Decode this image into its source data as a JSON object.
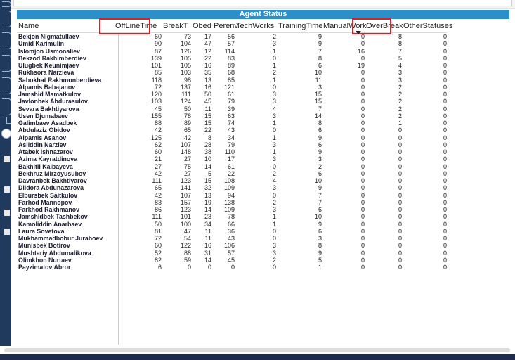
{
  "title": "Agent Status",
  "columns": [
    "Name",
    "OffLineTime",
    "BreakT",
    "Obed",
    "Pereriv",
    "TechWorks",
    "TrainingTime",
    "ManualWork",
    "OverBreak",
    "OtherStatuses"
  ],
  "rows": [
    [
      "Bekjon Nigmatullaev",
      "60",
      "73",
      "17",
      "56",
      "2",
      "9",
      "0",
      "8",
      "0"
    ],
    [
      "Umid Karimulin",
      "90",
      "104",
      "47",
      "57",
      "3",
      "9",
      "0",
      "8",
      "0"
    ],
    [
      "Islomjon Usmonaliev",
      "87",
      "126",
      "12",
      "114",
      "1",
      "7",
      "16",
      "7",
      "0"
    ],
    [
      "Bekzod Rakhimberdiev",
      "139",
      "105",
      "22",
      "83",
      "0",
      "8",
      "0",
      "5",
      "0"
    ],
    [
      "Ulugbek Keunimjaev",
      "101",
      "105",
      "16",
      "89",
      "1",
      "6",
      "19",
      "4",
      "0"
    ],
    [
      "Rukhsora Narzieva",
      "85",
      "103",
      "35",
      "68",
      "2",
      "10",
      "0",
      "3",
      "0"
    ],
    [
      "Sabokhat Rakhmonberdieva",
      "118",
      "98",
      "13",
      "85",
      "1",
      "11",
      "0",
      "3",
      "0"
    ],
    [
      "Alpamis Babajanov",
      "72",
      "137",
      "16",
      "121",
      "0",
      "3",
      "0",
      "2",
      "0"
    ],
    [
      "Jamshid Mamatkulov",
      "120",
      "111",
      "50",
      "61",
      "3",
      "15",
      "0",
      "2",
      "0"
    ],
    [
      "Javlonbek Abdurasulov",
      "103",
      "124",
      "45",
      "79",
      "3",
      "15",
      "0",
      "2",
      "0"
    ],
    [
      "Sevara Bakhtiyarova",
      "45",
      "50",
      "11",
      "39",
      "4",
      "7",
      "0",
      "2",
      "0"
    ],
    [
      "Usen Djumabaev",
      "155",
      "78",
      "15",
      "63",
      "3",
      "14",
      "0",
      "2",
      "0"
    ],
    [
      "Galimbaev Asadbek",
      "88",
      "89",
      "15",
      "74",
      "1",
      "8",
      "0",
      "1",
      "0"
    ],
    [
      "Abdulaziz Obidov",
      "42",
      "65",
      "22",
      "43",
      "0",
      "6",
      "0",
      "0",
      "0"
    ],
    [
      "Alpamis Asanov",
      "125",
      "42",
      "8",
      "34",
      "1",
      "9",
      "0",
      "0",
      "0"
    ],
    [
      "Asliddin Narziev",
      "62",
      "107",
      "28",
      "79",
      "3",
      "6",
      "0",
      "0",
      "0"
    ],
    [
      "Atabek Ishnazarov",
      "60",
      "148",
      "38",
      "110",
      "1",
      "9",
      "0",
      "0",
      "0"
    ],
    [
      "Azima Kayratdinova",
      "21",
      "27",
      "10",
      "17",
      "3",
      "3",
      "0",
      "0",
      "0"
    ],
    [
      "Bakhitil Kalbayeva",
      "27",
      "75",
      "14",
      "61",
      "0",
      "2",
      "0",
      "0",
      "0"
    ],
    [
      "Bekhruz Mirzoyusubov",
      "42",
      "27",
      "5",
      "22",
      "2",
      "6",
      "0",
      "0",
      "0"
    ],
    [
      "Davranbek Bakhtiyarov",
      "111",
      "123",
      "15",
      "108",
      "4",
      "10",
      "0",
      "0",
      "0"
    ],
    [
      "Dildora Abdunazarova",
      "65",
      "141",
      "32",
      "109",
      "3",
      "9",
      "0",
      "0",
      "0"
    ],
    [
      "Elbursbek Saitkulov",
      "42",
      "107",
      "13",
      "94",
      "0",
      "7",
      "0",
      "0",
      "0"
    ],
    [
      "Farhod Mannopov",
      "83",
      "157",
      "19",
      "138",
      "2",
      "7",
      "0",
      "0",
      "0"
    ],
    [
      "Farkhod Rakhmanov",
      "86",
      "123",
      "14",
      "109",
      "3",
      "6",
      "0",
      "0",
      "0"
    ],
    [
      "Jamshidbek Tashbekov",
      "111",
      "101",
      "23",
      "78",
      "1",
      "10",
      "0",
      "0",
      "0"
    ],
    [
      "Kamoliddin Anarbaev",
      "50",
      "100",
      "34",
      "66",
      "1",
      "9",
      "0",
      "0",
      "0"
    ],
    [
      "Laura Sovetova",
      "81",
      "47",
      "11",
      "36",
      "0",
      "6",
      "0",
      "0",
      "0"
    ],
    [
      "Mukhammadbobur Juraboev",
      "72",
      "54",
      "11",
      "43",
      "0",
      "3",
      "0",
      "0",
      "0"
    ],
    [
      "Munisbek Botirov",
      "60",
      "122",
      "16",
      "106",
      "3",
      "8",
      "0",
      "0",
      "0"
    ],
    [
      "Mushtariy Abdumalikova",
      "52",
      "88",
      "31",
      "57",
      "3",
      "9",
      "0",
      "0",
      "0"
    ],
    [
      "Olimkhon Nurtaev",
      "82",
      "59",
      "14",
      "45",
      "2",
      "5",
      "0",
      "0",
      "0"
    ],
    [
      "Payzimatov Abror",
      "6",
      "0",
      "0",
      "0",
      "0",
      "1",
      "0",
      "0",
      "0"
    ]
  ],
  "highlighted_columns": [
    "OffLineTime",
    "OverBreak"
  ],
  "sorted_column": "OverBreak",
  "colors": {
    "header_bar": "#2b8fc9",
    "sidebar": "#1f3a5c",
    "highlight": "#d6202a"
  }
}
